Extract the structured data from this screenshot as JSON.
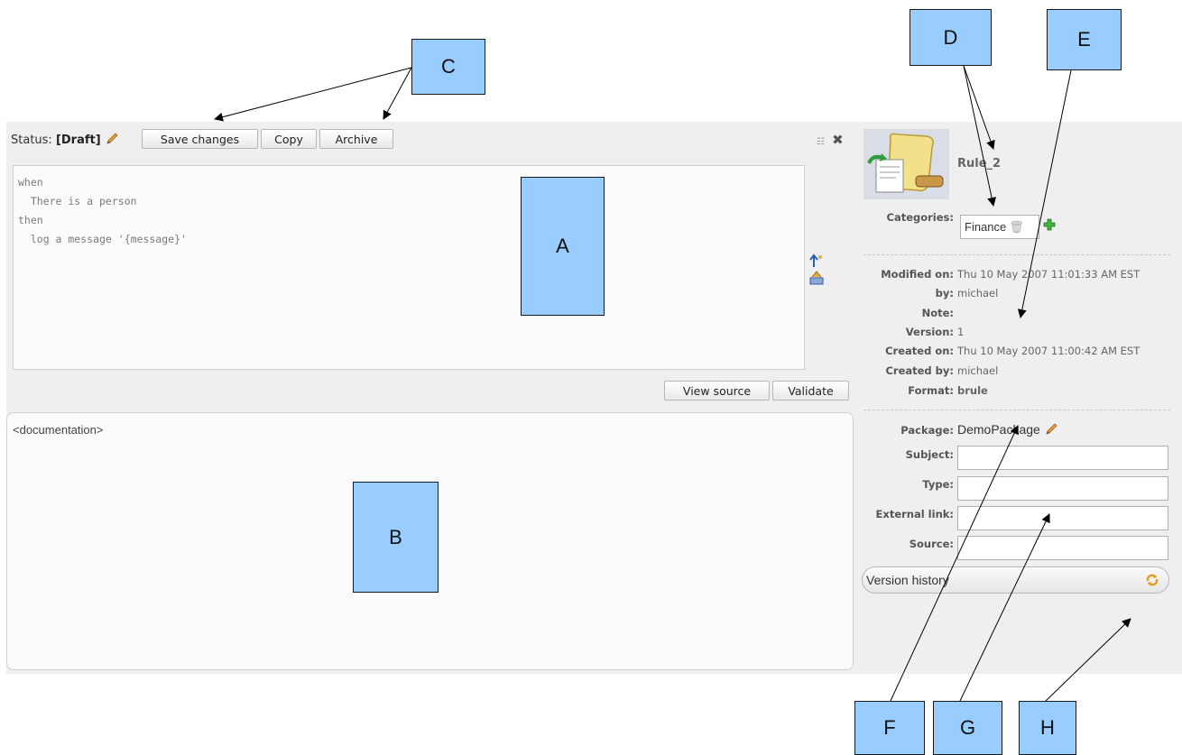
{
  "toolbar": {
    "status_label": "Status:",
    "status_value": "[Draft]",
    "save_label": "Save changes",
    "copy_label": "Copy",
    "archive_label": "Archive"
  },
  "editor": {
    "lines": [
      "when",
      "  There is a person",
      "then",
      "  log a message '{message}'"
    ]
  },
  "editor_actions": {
    "view_source_label": "View source",
    "validate_label": "Validate"
  },
  "documentation": {
    "placeholder": "<documentation>"
  },
  "asset": {
    "name": "Rule_2",
    "categories_label": "Categories:",
    "category": "Finance"
  },
  "meta": {
    "modified_on_label": "Modified on:",
    "modified_on": "Thu 10 May 2007 11:01:33 AM EST",
    "by_label": "by:",
    "by": "michael",
    "note_label": "Note:",
    "note": "",
    "version_label": "Version:",
    "version": "1",
    "created_on_label": "Created on:",
    "created_on": "Thu 10 May 2007 11:00:42 AM EST",
    "created_by_label": "Created by:",
    "created_by": "michael",
    "format_label": "Format:",
    "format": "brule"
  },
  "props": {
    "package_label": "Package:",
    "package": "DemoPackage",
    "subject_label": "Subject:",
    "subject": "",
    "type_label": "Type:",
    "type": "",
    "external_link_label": "External link:",
    "external_link": "",
    "source_label": "Source:",
    "source": ""
  },
  "version_history": {
    "label": "Version history"
  },
  "callouts": {
    "a": "A",
    "b": "B",
    "c": "C",
    "d": "D",
    "e": "E",
    "f": "F",
    "g": "G",
    "h": "H"
  },
  "colors": {
    "callout_fill": "#99ccff",
    "panel_bg": "#efefef"
  }
}
